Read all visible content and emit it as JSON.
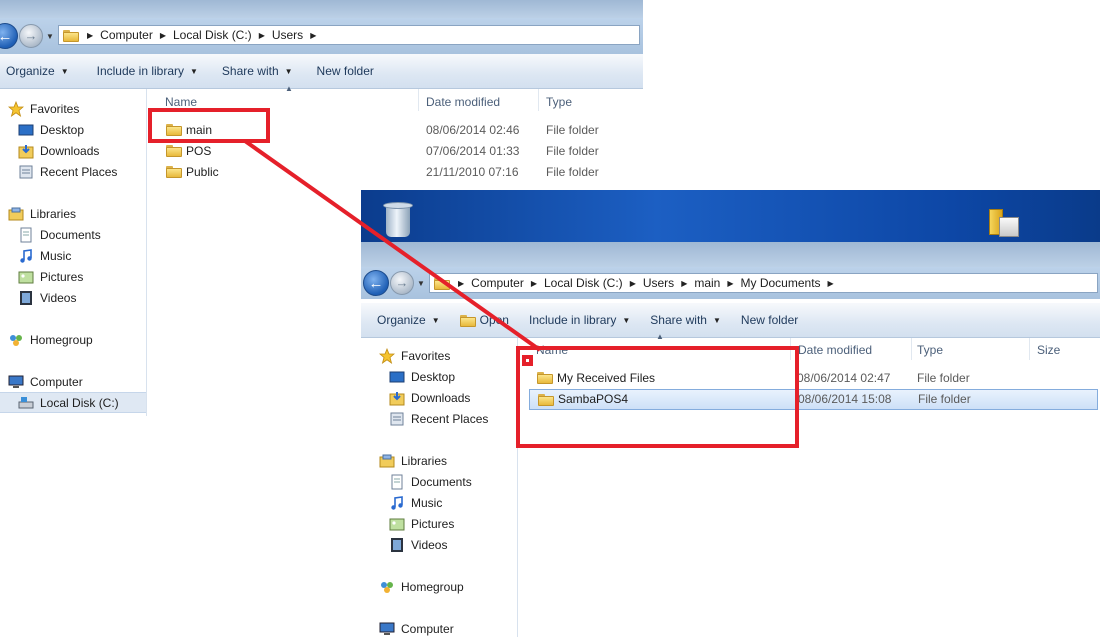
{
  "window1": {
    "address": [
      "Computer",
      "Local Disk (C:)",
      "Users"
    ],
    "commands": {
      "organize": "Organize",
      "include": "Include in library",
      "share": "Share with",
      "new_folder": "New folder"
    },
    "columns": {
      "name": "Name",
      "date": "Date modified",
      "type": "Type"
    },
    "nav": {
      "favorites": "Favorites",
      "desktop": "Desktop",
      "downloads": "Downloads",
      "recent": "Recent Places",
      "libraries": "Libraries",
      "documents": "Documents",
      "music": "Music",
      "pictures": "Pictures",
      "videos": "Videos",
      "homegroup": "Homegroup",
      "computer": "Computer",
      "local_disk": "Local Disk (C:)"
    },
    "files": [
      {
        "name": "main",
        "date": "08/06/2014 02:46",
        "type": "File folder"
      },
      {
        "name": "POS",
        "date": "07/06/2014 01:33",
        "type": "File folder"
      },
      {
        "name": "Public",
        "date": "21/11/2010 07:16",
        "type": "File folder"
      }
    ]
  },
  "window2": {
    "address": [
      "Computer",
      "Local Disk (C:)",
      "Users",
      "main",
      "My Documents"
    ],
    "commands": {
      "organize": "Organize",
      "open": "Open",
      "include": "Include in library",
      "share": "Share with",
      "new_folder": "New folder"
    },
    "columns": {
      "name": "Name",
      "date": "Date modified",
      "type": "Type",
      "size": "Size"
    },
    "nav": {
      "favorites": "Favorites",
      "desktop": "Desktop",
      "downloads": "Downloads",
      "recent": "Recent Places",
      "libraries": "Libraries",
      "documents": "Documents",
      "music": "Music",
      "pictures": "Pictures",
      "videos": "Videos",
      "homegroup": "Homegroup",
      "computer": "Computer"
    },
    "files": [
      {
        "name": "My Received Files",
        "date": "08/06/2014 02:47",
        "type": "File folder"
      },
      {
        "name": "SambaPOS4",
        "date": "08/06/2014 15:08",
        "type": "File folder",
        "selected": true
      }
    ]
  },
  "colors": {
    "annotation": "#e5202a",
    "selection": "#cde0f7",
    "accent": "#1e395b"
  }
}
